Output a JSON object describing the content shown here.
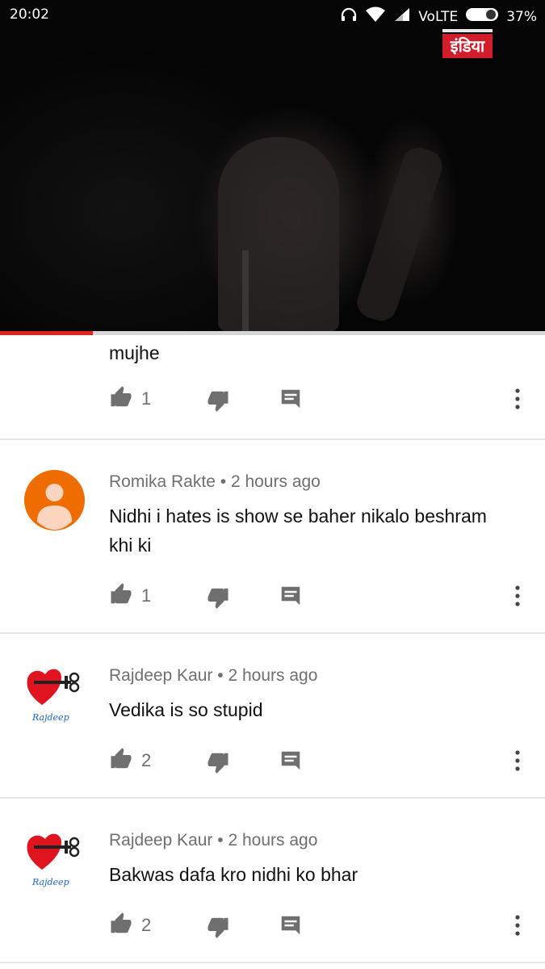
{
  "status_bar": {
    "time": "20:02",
    "network": "VoLTE",
    "battery": "37%",
    "icons": [
      "headset-icon",
      "wifi-icon",
      "signal-icon",
      "battery-icon"
    ]
  },
  "video": {
    "channel_logo_text": "इंडिया",
    "progress_fraction": 0.17
  },
  "partial_comment": {
    "text": "mujhe",
    "likes": "1"
  },
  "comments": [
    {
      "author": "Romika Rakte",
      "separator": "•",
      "time": "2 hours ago",
      "text": "Nidhi i hates is show se baher nikalo beshram khi ki",
      "likes": "1",
      "avatar": "default-orange"
    },
    {
      "author": "Rajdeep Kaur",
      "separator": "•",
      "time": "2 hours ago",
      "text": "Vedika is so stupid",
      "likes": "2",
      "avatar": "heart-key"
    },
    {
      "author": "Rajdeep Kaur",
      "separator": "•",
      "time": "2 hours ago",
      "text": "Bakwas dafa kro nidhi ko bhar",
      "likes": "2",
      "avatar": "heart-key"
    }
  ],
  "avatar_signature_text": "Rajdeep",
  "colors": {
    "progress_red": "#e62117",
    "avatar_orange": "#ef6c00",
    "heart_red": "#e0141e",
    "icon_gray": "#6f6f6f"
  }
}
